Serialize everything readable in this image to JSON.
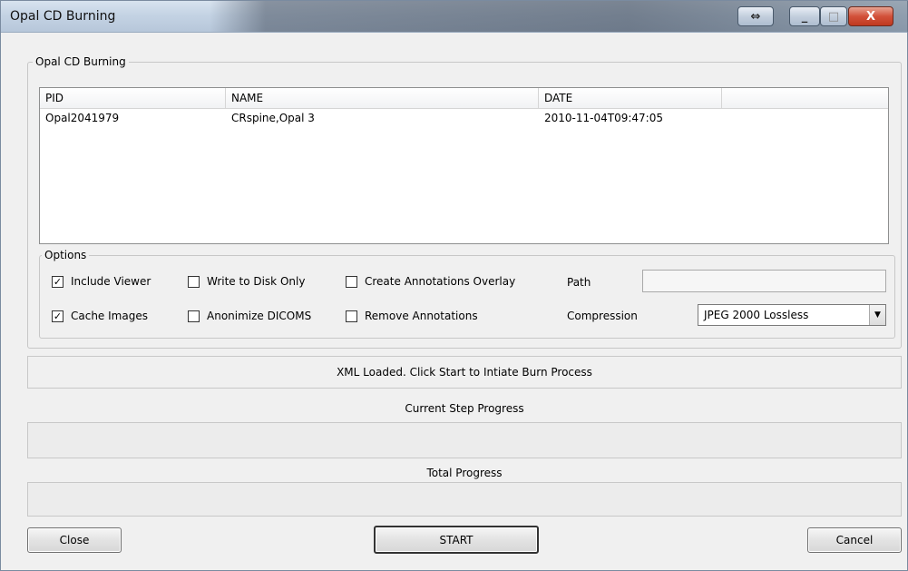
{
  "window": {
    "title": "Opal CD Burning"
  },
  "titlebar_buttons": {
    "resize": "⇔",
    "minimize": "_",
    "maximize": "□",
    "close": "X"
  },
  "group": {
    "legend": "Opal CD Burning"
  },
  "list": {
    "columns": [
      "PID",
      "NAME",
      "DATE",
      ""
    ],
    "rows": [
      {
        "pid": "Opal2041979",
        "name": "CRspine,Opal 3",
        "date": "2010-11-04T09:47:05"
      }
    ]
  },
  "options": {
    "legend": "Options",
    "include_viewer": {
      "label": "Include Viewer",
      "checked": true
    },
    "write_to_disk_only": {
      "label": "Write to Disk Only",
      "checked": false
    },
    "create_annotations_overlay": {
      "label": "Create Annotations Overlay",
      "checked": false
    },
    "cache_images": {
      "label": "Cache Images",
      "checked": true
    },
    "anonimize_dicoms": {
      "label": "Anonimize DICOMS",
      "checked": false
    },
    "remove_annotations": {
      "label": "Remove Annotations",
      "checked": false
    },
    "path": {
      "label": "Path",
      "value": ""
    },
    "compression": {
      "label": "Compression",
      "value": "JPEG 2000 Lossless"
    }
  },
  "status": {
    "message": "XML Loaded. Click Start to Intiate Burn Process"
  },
  "progress": {
    "current_label": "Current Step Progress",
    "current_value": 0,
    "total_label": "Total Progress",
    "total_value": 0
  },
  "buttons": {
    "close": "Close",
    "start": "START",
    "cancel": "Cancel"
  }
}
